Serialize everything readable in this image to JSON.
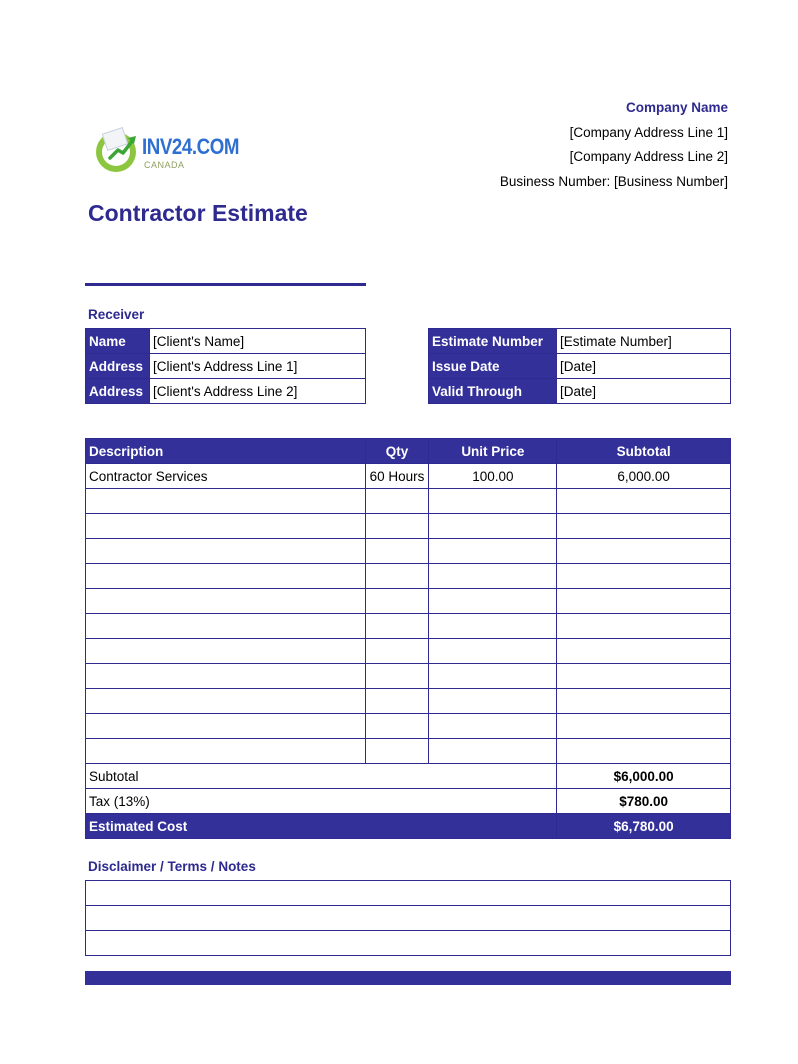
{
  "logo": {
    "text": "INV24.COM",
    "subtext": "CANADA"
  },
  "company": {
    "name": "Company Name",
    "address_line_1": "[Company Address Line 1]",
    "address_line_2": "[Company Address Line 2]",
    "business_number": "Business Number: [Business Number]"
  },
  "document": {
    "title": "Contractor Estimate"
  },
  "receiver": {
    "heading": "Receiver",
    "rows": [
      {
        "label": "Name",
        "value": "[Client's Name]"
      },
      {
        "label": "Address",
        "value": "[Client's Address Line 1]"
      },
      {
        "label": "Address",
        "value": "[Client's Address Line 2]"
      }
    ]
  },
  "estimate_info": {
    "rows": [
      {
        "label": "Estimate Number",
        "value": "[Estimate Number]"
      },
      {
        "label": "Issue Date",
        "value": "[Date]"
      },
      {
        "label": "Valid Through",
        "value": "[Date]"
      }
    ]
  },
  "items": {
    "headers": {
      "description": "Description",
      "qty": "Qty",
      "unit_price": "Unit Price",
      "subtotal": "Subtotal"
    },
    "rows": [
      {
        "description": "Contractor Services",
        "qty": "60 Hours",
        "unit_price": "100.00",
        "subtotal": "6,000.00"
      },
      {
        "description": "",
        "qty": "",
        "unit_price": "",
        "subtotal": ""
      },
      {
        "description": "",
        "qty": "",
        "unit_price": "",
        "subtotal": ""
      },
      {
        "description": "",
        "qty": "",
        "unit_price": "",
        "subtotal": ""
      },
      {
        "description": "",
        "qty": "",
        "unit_price": "",
        "subtotal": ""
      },
      {
        "description": "",
        "qty": "",
        "unit_price": "",
        "subtotal": ""
      },
      {
        "description": "",
        "qty": "",
        "unit_price": "",
        "subtotal": ""
      },
      {
        "description": "",
        "qty": "",
        "unit_price": "",
        "subtotal": ""
      },
      {
        "description": "",
        "qty": "",
        "unit_price": "",
        "subtotal": ""
      },
      {
        "description": "",
        "qty": "",
        "unit_price": "",
        "subtotal": ""
      },
      {
        "description": "",
        "qty": "",
        "unit_price": "",
        "subtotal": ""
      },
      {
        "description": "",
        "qty": "",
        "unit_price": "",
        "subtotal": ""
      }
    ]
  },
  "totals": {
    "subtotal_label": "Subtotal",
    "subtotal_value": "$6,000.00",
    "tax_label": "Tax (13%)",
    "tax_value": "$780.00",
    "estimated_label": "Estimated Cost",
    "estimated_value": "$6,780.00"
  },
  "notes": {
    "heading": "Disclaimer / Terms / Notes",
    "lines": [
      "",
      "",
      ""
    ]
  },
  "colors": {
    "brand_navy": "#33309a",
    "logo_green": "#8cc63f",
    "logo_blue": "#2f6fd1"
  }
}
